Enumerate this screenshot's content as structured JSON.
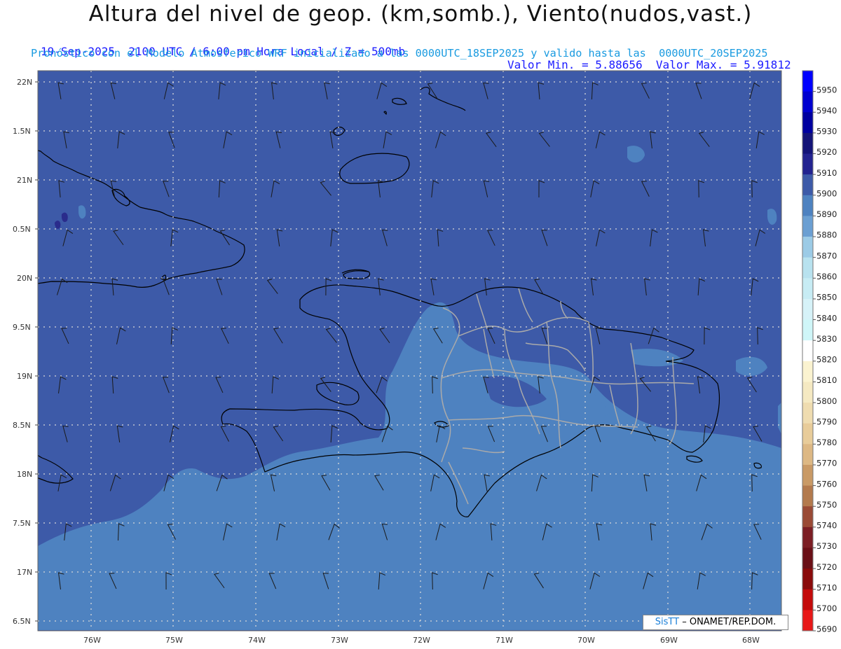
{
  "header": {
    "title": "Altura del nivel de geop. (km,somb.), Viento(nudos,vast.)",
    "line1_left": "19-Sep-2025  2100 UTC / 6:00 pm Hora Local / Z = 500mb",
    "line1_right": "Valor Min. = 5.88656  Valor Max. = 5.91812",
    "line2": "Pronóstico con el Modelo Atmosferico WRF inicializado a las 0000UTC_18SEP2025 y valido hasta las  0000UTC_20SEP2025"
  },
  "map": {
    "lat_labels": [
      "22N",
      "1.5N",
      "21N",
      "0.5N",
      "20N",
      "9.5N",
      "19N",
      "8.5N",
      "18N",
      "7.5N",
      "17N",
      "6.5N"
    ],
    "lon_labels": [
      "76W",
      "75W",
      "74W",
      "73W",
      "72W",
      "71W",
      "70W",
      "69W",
      "68W"
    ],
    "fill_colors": {
      "base": "#3d5aa8",
      "light": "#4e82c0",
      "lighter": "#5d96cc",
      "dark": "#2e3a96",
      "darkest": "#1a1a80"
    }
  },
  "colorbar": {
    "levels": [
      "5950",
      "5940",
      "5930",
      "5920",
      "5910",
      "5900",
      "5890",
      "5880",
      "5870",
      "5860",
      "5850",
      "5840",
      "5830",
      "5820",
      "5810",
      "5800",
      "5790",
      "5780",
      "5770",
      "5760",
      "5750",
      "5740",
      "5730",
      "5720",
      "5710",
      "5700",
      "5690"
    ],
    "colors": [
      "#0000ff",
      "#0000d0",
      "#0000a0",
      "#141478",
      "#232390",
      "#3d5aa8",
      "#4e82c0",
      "#6b9fd2",
      "#9ccbe6",
      "#b8e2ef",
      "#c7ecf4",
      "#d6f2f8",
      "#cff6f8",
      "#ffffff",
      "#fbf3d0",
      "#f5e9c2",
      "#efdcb0",
      "#e8cc9a",
      "#ddb884",
      "#c99a66",
      "#b37a4d",
      "#9a4a35",
      "#7c1e24",
      "#6a0f16",
      "#8a0a0a",
      "#c40a0a",
      "#e81818"
    ]
  },
  "credit": {
    "brand": "SisTT",
    "text": "– ONAMET/REP.DOM."
  }
}
